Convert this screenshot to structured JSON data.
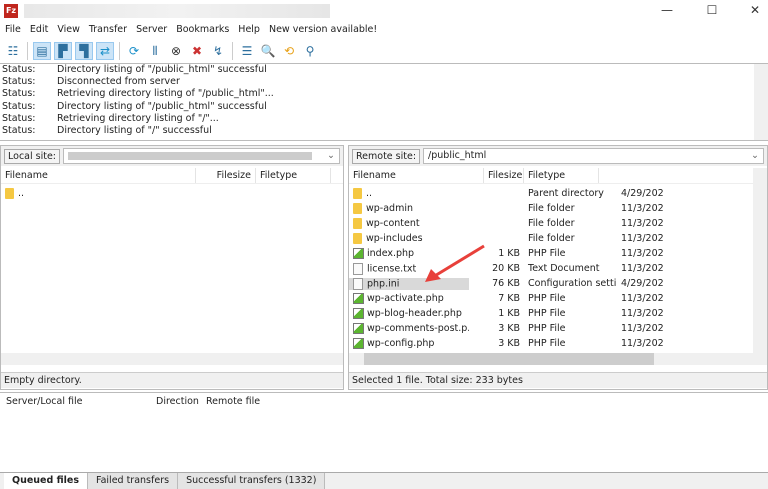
{
  "window": {
    "app_icon": "Fz",
    "minimize": "—",
    "maximize": "☐",
    "close": "✕"
  },
  "menu": [
    "File",
    "Edit",
    "View",
    "Transfer",
    "Server",
    "Bookmarks",
    "Help",
    "New version available!"
  ],
  "toolbar": [
    "site-manager",
    "toggle-log",
    "toggle-local-tree",
    "toggle-remote-tree",
    "toggle-transfer-queue",
    "refresh",
    "process-queue",
    "cancel",
    "disconnect",
    "reconnect",
    "directory-filter",
    "toggle-comparison",
    "sync-browsing",
    "search"
  ],
  "log": [
    {
      "k": "Status:",
      "v": "Directory listing of \"/public_html\" successful"
    },
    {
      "k": "Status:",
      "v": "Disconnected from server"
    },
    {
      "k": "Status:",
      "v": "Retrieving directory listing of \"/public_html\"..."
    },
    {
      "k": "Status:",
      "v": "Directory listing of \"/public_html\" successful"
    },
    {
      "k": "Status:",
      "v": "Retrieving directory listing of \"/\"..."
    },
    {
      "k": "Status:",
      "v": "Directory listing of \"/\" successful"
    }
  ],
  "local": {
    "label": "Local site:",
    "path": "",
    "cols": [
      "Filename",
      "Filesize",
      "Filetype"
    ],
    "rows": [
      {
        "name": ".."
      }
    ],
    "status": "Empty directory."
  },
  "remote": {
    "label": "Remote site:",
    "path": "/public_html",
    "cols": [
      "Filename",
      "Filesize",
      "Filetype"
    ],
    "rows": [
      {
        "icon": "parent",
        "name": "..",
        "size": "",
        "type": "Parent directory",
        "date": "4/29/202"
      },
      {
        "icon": "folder",
        "name": "wp-admin",
        "size": "",
        "type": "File folder",
        "date": "11/3/202"
      },
      {
        "icon": "folder",
        "name": "wp-content",
        "size": "",
        "type": "File folder",
        "date": "11/3/202"
      },
      {
        "icon": "folder",
        "name": "wp-includes",
        "size": "",
        "type": "File folder",
        "date": "11/3/202"
      },
      {
        "icon": "php",
        "name": "index.php",
        "size": "1 KB",
        "type": "PHP File",
        "date": "11/3/202"
      },
      {
        "icon": "doc",
        "name": "license.txt",
        "size": "20 KB",
        "type": "Text Document",
        "date": "11/3/202"
      },
      {
        "icon": "doc",
        "name": "php.ini",
        "size": "76 KB",
        "type": "Configuration setti...",
        "date": "4/29/202",
        "selected": true
      },
      {
        "icon": "php",
        "name": "wp-activate.php",
        "size": "7 KB",
        "type": "PHP File",
        "date": "11/3/202"
      },
      {
        "icon": "php",
        "name": "wp-blog-header.php",
        "size": "1 KB",
        "type": "PHP File",
        "date": "11/3/202"
      },
      {
        "icon": "php",
        "name": "wp-comments-post.p...",
        "size": "3 KB",
        "type": "PHP File",
        "date": "11/3/202"
      },
      {
        "icon": "php",
        "name": "wp-config.php",
        "size": "3 KB",
        "type": "PHP File",
        "date": "11/3/202"
      }
    ],
    "status": "Selected 1 file. Total size: 233 bytes"
  },
  "queue": {
    "cols": [
      "Server/Local file",
      "Direction",
      "Remote file"
    ],
    "tabs": [
      "Queued files",
      "Failed transfers",
      "Successful transfers (1332)"
    ]
  },
  "colors": {
    "annotation_arrow": "#e8403a",
    "selection": "#d9d9d9",
    "folder": "#f5c842"
  }
}
